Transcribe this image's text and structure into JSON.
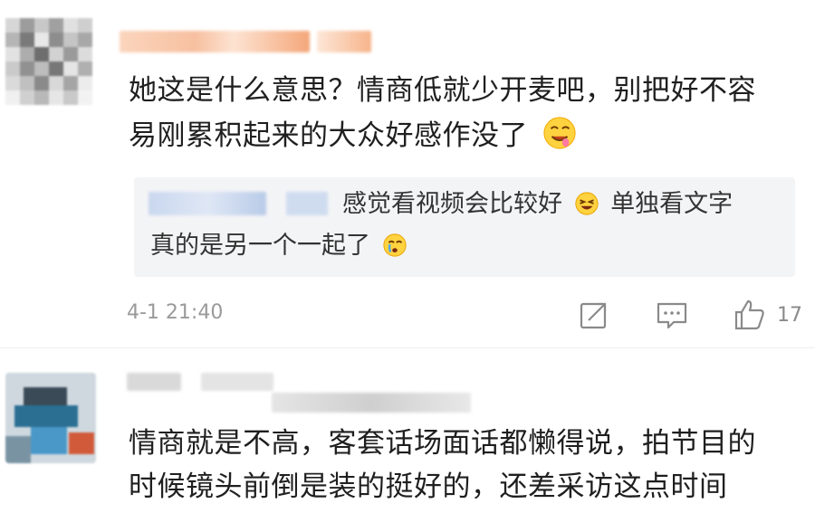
{
  "comment1": {
    "text_line1": "她这是什么意思？情商低就少开麦吧，别把好不容",
    "text_line2": "易刚累积起来的大众好感作没了",
    "reply": {
      "line1_a": "感觉看视频会比较好",
      "line1_b": "单独看文字",
      "line2": "真的是另一个一起了"
    },
    "timestamp": "4-1 21:40",
    "like_count": "17"
  },
  "comment2": {
    "text_line1": "情商就是不高，客套话场面话都懒得说，拍节目的",
    "text_line2": "时候镜头前倒是装的挺好的，还差采访这点时间"
  },
  "icons": {
    "share": "share-icon",
    "reply": "comment-icon",
    "like": "thumbs-up-icon"
  },
  "colors": {
    "accent_name": "#f4a77a",
    "meta_text": "#9a9a9a",
    "reply_bg": "#f3f4f6"
  }
}
